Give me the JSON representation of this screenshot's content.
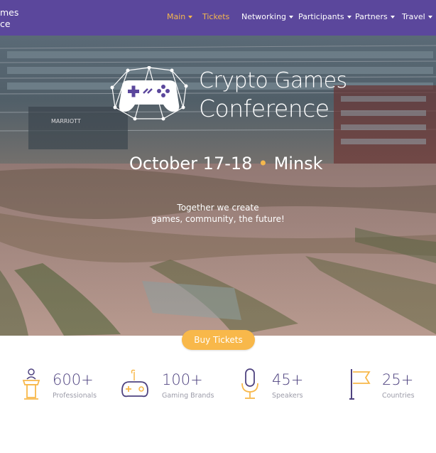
{
  "brand": {
    "line1": "mes",
    "line2": "ce"
  },
  "nav": [
    {
      "label": "Main",
      "dropdown": true,
      "active": true
    },
    {
      "label": "Tickets",
      "dropdown": false,
      "active": true
    },
    {
      "label": "Networking",
      "dropdown": true,
      "active": false
    },
    {
      "label": "Participants",
      "dropdown": true,
      "active": false
    },
    {
      "label": "Partners",
      "dropdown": true,
      "active": false
    },
    {
      "label": "Travel",
      "dropdown": true,
      "active": false
    }
  ],
  "hero": {
    "title_line1": "Crypto Games",
    "title_line2": "Conference",
    "date": "October 17-18",
    "city": "Minsk",
    "tagline_line1": "Together we create",
    "tagline_line2": "games, community, the future!",
    "building_sign": "MARRIOTT",
    "logo_icon": "gamepad-network-logo"
  },
  "cta": {
    "label": "Buy Tickets"
  },
  "stats": [
    {
      "value": "600+",
      "label": "Professionals",
      "icon": "podium-speaker-icon"
    },
    {
      "value": "100+",
      "label": "Gaming Brands",
      "icon": "gamepad-icon"
    },
    {
      "value": "45+",
      "label": "Speakers",
      "icon": "microphone-icon"
    },
    {
      "value": "25+",
      "label": "Countries",
      "icon": "flag-icon"
    }
  ],
  "colors": {
    "nav_bg": "#5b479c",
    "accent": "#f8b84a",
    "stat_number": "#4f4380",
    "stat_label": "#9b9ba8",
    "icon_dark": "#4f4380",
    "icon_accent": "#f8b84a"
  }
}
